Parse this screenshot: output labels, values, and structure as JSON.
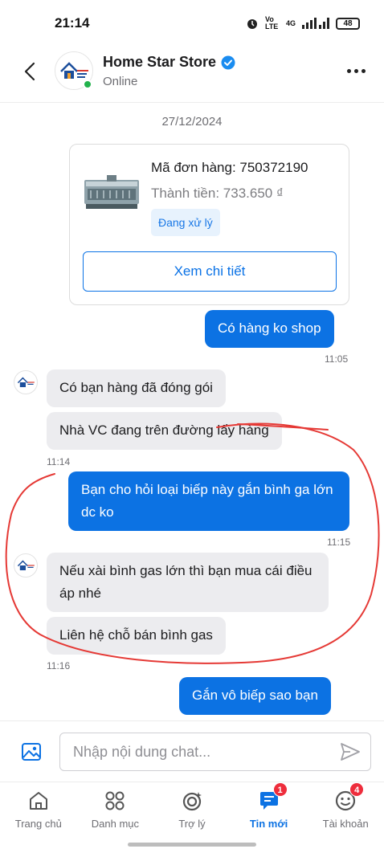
{
  "status_bar": {
    "time": "21:14",
    "network": "Vo LTE",
    "signal": "4G",
    "battery": "48"
  },
  "header": {
    "store_name": "Home Star Store",
    "status": "Online"
  },
  "chat": {
    "date": "27/12/2024",
    "order": {
      "id_label": "Mã đơn hàng: 750372190",
      "total_label": "Thành tiền: 733.650 ₫",
      "status": "Đang xử lý",
      "detail_button": "Xem chi tiết"
    },
    "messages": [
      {
        "from": "me",
        "text": "Có hàng ko shop",
        "time": "11:05"
      },
      {
        "from": "shop",
        "text": "Có bạn hàng đã đóng gói"
      },
      {
        "from": "shop",
        "text": "Nhà VC đang trên đường lấy hàng",
        "time": "11:14"
      },
      {
        "from": "me",
        "text": "Bạn cho hỏi loại biếp này gắn bình ga lớn dc ko",
        "time": "11:15"
      },
      {
        "from": "shop",
        "text": "Nếu xài bình gas lớn thì bạn mua cái điều áp nhé"
      },
      {
        "from": "shop",
        "text": "Liên hệ chỗ bán bình gas",
        "time": "11:16"
      },
      {
        "from": "me",
        "text": "Gắn vô biếp sao bạn"
      }
    ],
    "annotation_color": "#e53935"
  },
  "input": {
    "placeholder": "Nhập nội dung chat..."
  },
  "bottom_nav": {
    "items": [
      {
        "label": "Trang chủ",
        "icon": "home-icon"
      },
      {
        "label": "Danh mục",
        "icon": "grid-icon"
      },
      {
        "label": "Trợ lý",
        "icon": "assistant-icon"
      },
      {
        "label": "Tin mới",
        "icon": "chat-icon",
        "badge": "1",
        "active": true
      },
      {
        "label": "Tài khoản",
        "icon": "account-icon",
        "badge": "4"
      }
    ]
  },
  "colors": {
    "primary": "#0c72e3",
    "incoming_bubble": "#ececef",
    "online": "#22b24c",
    "badge": "#ee2d3c"
  }
}
